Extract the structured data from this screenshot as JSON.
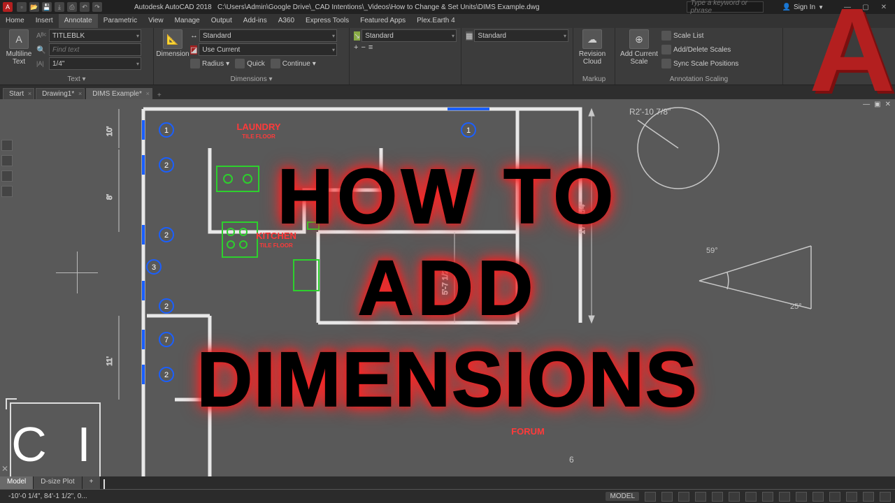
{
  "title": {
    "app": "Autodesk AutoCAD 2018",
    "path": "C:\\Users\\Admin\\Google Drive\\_CAD Intentions\\_Videos\\How to Change & Set Units\\DIMS Example.dwg",
    "search_placeholder": "Type a keyword or phrase",
    "signin": "Sign In"
  },
  "menu": {
    "tabs": [
      "Home",
      "Insert",
      "Annotate",
      "Parametric",
      "View",
      "Manage",
      "Output",
      "Add-ins",
      "A360",
      "Express Tools",
      "Featured Apps",
      "Plex.Earth 4"
    ],
    "active": "Annotate"
  },
  "ribbon": {
    "text_panel": {
      "label": "Text ▾",
      "multiline": "Multiline Text",
      "style_combo": "TITLEBLK",
      "find_placeholder": "Find text",
      "height_combo": "1/4\""
    },
    "dim_panel": {
      "label": "Dimensions ▾",
      "dimension": "Dimension",
      "style_combo": "Standard",
      "layer_combo": "Use Current",
      "radius": "Radius",
      "quick": "Quick",
      "continue": "Continue"
    },
    "leader_panel": {
      "style_combo": "Standard"
    },
    "table_panel": {
      "style_combo": "Standard"
    },
    "markup_panel": {
      "revision": "Revision Cloud",
      "label": "Markup"
    },
    "scale_panel": {
      "add_current": "Add Current Scale",
      "scale_list": "Scale List",
      "add_delete": "Add/Delete Scales",
      "sync": "Sync Scale Positions",
      "label": "Annotation Scaling"
    }
  },
  "doctabs": {
    "tabs": [
      "Start",
      "Drawing1*",
      "DIMS Example*"
    ],
    "active": "DIMS Example*"
  },
  "canvas": {
    "rooms": {
      "laundry": "LAUNDRY",
      "kitchen": "KITCHEN",
      "forum": "FORUM"
    },
    "sub": "TILE FLOOR",
    "dims": {
      "d10": "10'",
      "d8": "8'",
      "d11": "11'",
      "r2_10": "R2'-10 7/8\"",
      "a59": "59°",
      "a25": "25°",
      "v17": "17'-3 1/4\"",
      "v5": "5'-7 1/2\""
    },
    "markers": [
      "1",
      "2",
      "2",
      "3",
      "2",
      "7",
      "2",
      "6",
      "1"
    ]
  },
  "layout_tabs": {
    "tabs": [
      "Model",
      "D-size Plot"
    ],
    "active": "Model"
  },
  "status": {
    "coords": "-10'-0 1/4\", 84'-1 1/2\", 0...",
    "model": "MODEL"
  },
  "overlay": {
    "l1": "HOW TO",
    "l2": "ADD",
    "l3": "DIMENSIONS"
  },
  "ci": "C I"
}
